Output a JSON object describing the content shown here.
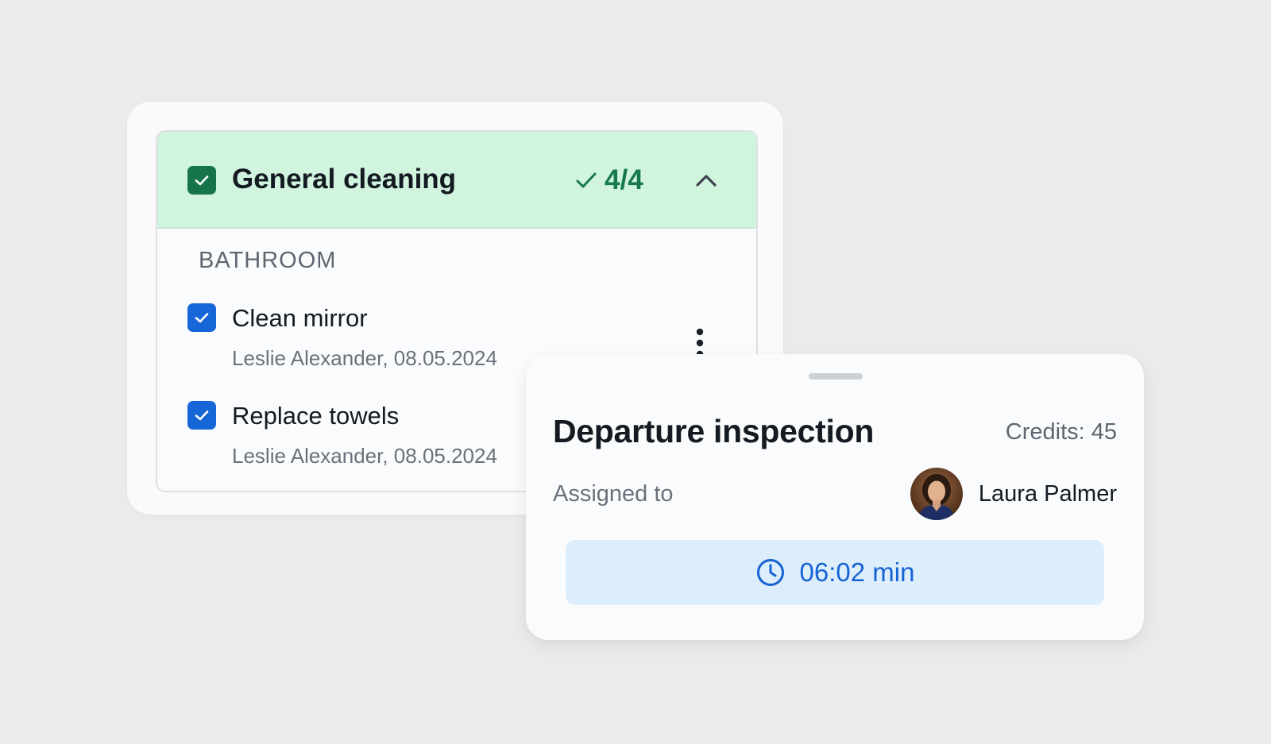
{
  "colors": {
    "page_background": "#eaebed",
    "section_header_green": "#d1f4df",
    "done_green": "#15744a",
    "checkbox_blue": "#1666d8",
    "timer_background": "#dcedfb",
    "timer_text": "#1663d4"
  },
  "checklist": {
    "section": {
      "title": "General cleaning",
      "checked": true,
      "progress": "4/4",
      "progress_icon": "check-icon",
      "collapse_icon": "chevron-up-icon"
    },
    "group": {
      "label": "BATHROOM",
      "items": [
        {
          "title": "Clean mirror",
          "meta": "Leslie Alexander, 08.05.2024",
          "checked": true
        },
        {
          "title": "Replace towels",
          "meta": "Leslie Alexander, 08.05.2024",
          "checked": true
        }
      ]
    },
    "more_icon": "more-vertical-icon"
  },
  "sheet": {
    "title": "Departure inspection",
    "credits": "Credits: 45",
    "assigned_label": "Assigned to",
    "assignee": {
      "name": "Laura Palmer",
      "avatar_icon": "avatar"
    },
    "timer": {
      "icon": "clock-icon",
      "value": "06:02 min"
    }
  }
}
